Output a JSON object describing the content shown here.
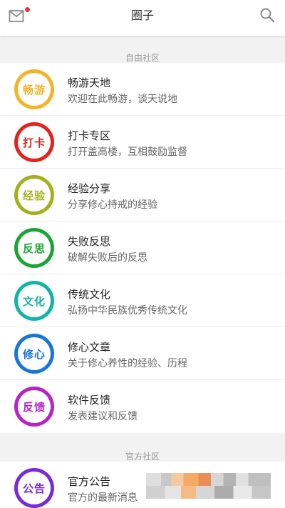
{
  "header": {
    "title": "圈子",
    "mail_icon": "mail-icon",
    "search_icon": "search-icon",
    "notification_color": "#e53935"
  },
  "sections": [
    {
      "label": "自由社区",
      "items": [
        {
          "badge": "畅游",
          "color": "#f5b324",
          "title": "畅游天地",
          "desc": "欢迎在此畅游，谈天说地"
        },
        {
          "badge": "打卡",
          "color": "#e5231b",
          "title": "打卡专区",
          "desc": "打开盖高楼，互相鼓励监督"
        },
        {
          "badge": "经验",
          "color": "#a3b21a",
          "title": "经验分享",
          "desc": "分享修心持戒的经验"
        },
        {
          "badge": "反思",
          "color": "#1aa634",
          "title": "失败反思",
          "desc": "破解失败后的反思"
        },
        {
          "badge": "文化",
          "color": "#12b5a6",
          "title": "传统文化",
          "desc": "弘扬中华民族优秀传统文化"
        },
        {
          "badge": "修心",
          "color": "#1777d8",
          "title": "修心文章",
          "desc": "关于修心养性的经验、历程"
        },
        {
          "badge": "反馈",
          "color": "#b823c9",
          "title": "软件反馈",
          "desc": "发表建议和反馈"
        }
      ]
    },
    {
      "label": "官方社区",
      "items": [
        {
          "badge": "公告",
          "color": "#7a2bd6",
          "title": "官方公告",
          "desc": "官方的最新消息"
        }
      ]
    }
  ]
}
